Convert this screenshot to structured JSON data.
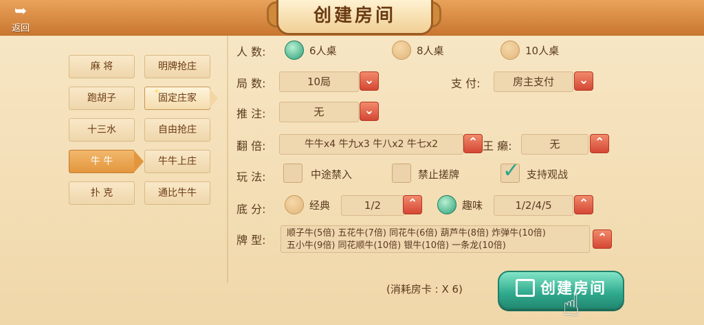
{
  "header": {
    "back_label": "返回",
    "title": "创建房间"
  },
  "left_tabs": [
    {
      "label": "麻 将"
    },
    {
      "label": "跑胡子"
    },
    {
      "label": "十三水"
    },
    {
      "label": "牛 牛"
    },
    {
      "label": "扑 克"
    }
  ],
  "sub_tabs": [
    {
      "label": "明牌抢庄"
    },
    {
      "label": "固定庄家"
    },
    {
      "label": "自由抢庄"
    },
    {
      "label": "牛牛上庄"
    },
    {
      "label": "通比牛牛"
    }
  ],
  "form": {
    "players": {
      "label": "人 数:",
      "options": [
        "6人桌",
        "8人桌",
        "10人桌"
      ]
    },
    "rounds": {
      "label": "局 数:",
      "value": "10局"
    },
    "pay": {
      "label": "支 付:",
      "value": "房主支付"
    },
    "push": {
      "label": "推 注:",
      "value": "无"
    },
    "multiple": {
      "label": "翻 倍:",
      "value": "牛牛x4 牛九x3 牛八x2 牛七x2"
    },
    "wild": {
      "label": "王 癞:",
      "value": "无"
    },
    "play": {
      "label": "玩 法:",
      "options": [
        "中途禁入",
        "禁止搓牌",
        "支持观战"
      ]
    },
    "base": {
      "label": "底 分:",
      "classic_label": "经典",
      "classic_value": "1/2",
      "fun_label": "趣味",
      "fun_value": "1/2/4/5"
    },
    "card_types": {
      "label": "牌 型:",
      "line1": "顺子牛(5倍) 五花牛(7倍) 同花牛(6倍) 葫芦牛(8倍) 炸弹牛(10倍)",
      "line2": "五小牛(9倍) 同花顺牛(10倍) 银牛(10倍) 一条龙(10倍)"
    }
  },
  "footer": {
    "cost": "(消耗房卡 : X 6)",
    "create_label": "创建房间"
  },
  "icons": {
    "down": "chevron-down-icon",
    "up": "chevron-up-icon",
    "check": "checkmark-icon"
  },
  "colors": {
    "accent": "#2fa98d",
    "header": "#c9762f",
    "dropdown": "#d44734"
  }
}
